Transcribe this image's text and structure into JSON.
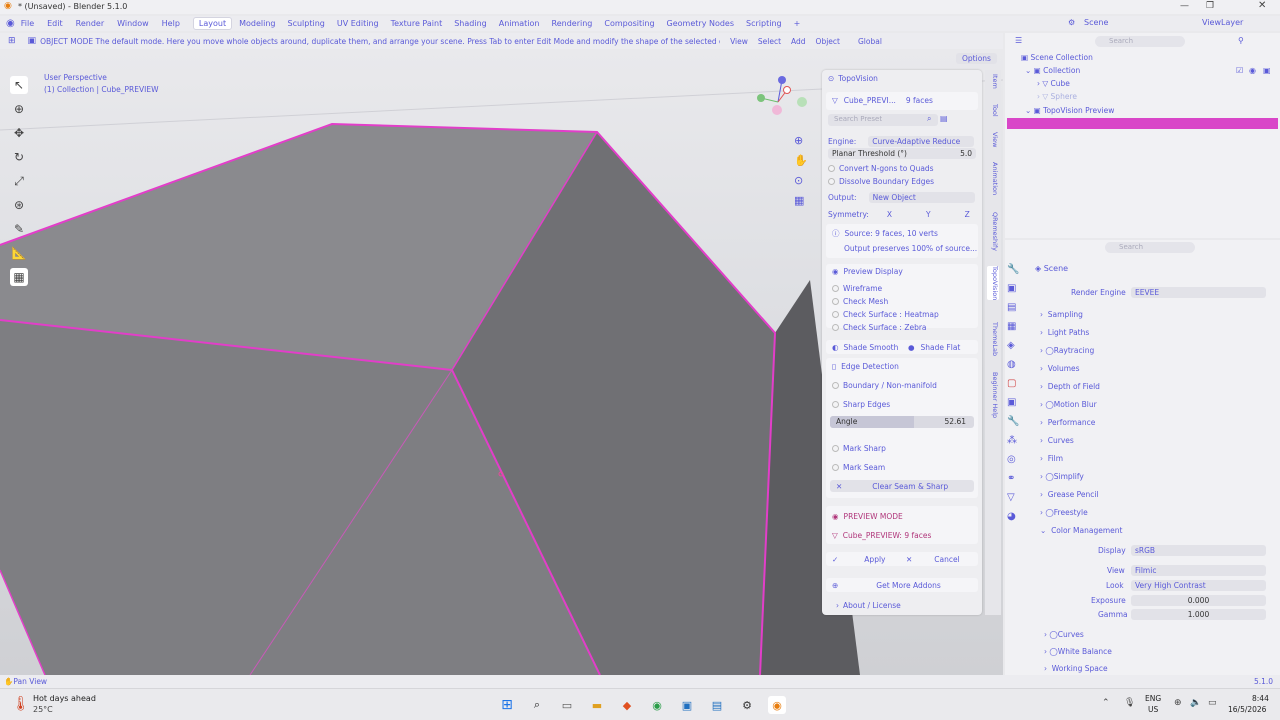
{
  "window": {
    "title": "* (Unsaved) - Blender 5.1.0"
  },
  "menu": {
    "items": [
      "File",
      "Edit",
      "Render",
      "Window",
      "Help"
    ],
    "workspaces": [
      "Layout",
      "Modeling",
      "Sculpting",
      "UV Editing",
      "Texture Paint",
      "Shading",
      "Animation",
      "Rendering",
      "Compositing",
      "Geometry Nodes",
      "Scripting"
    ],
    "active_workspace": "Layout",
    "scene": "Scene",
    "view_layer": "ViewLayer"
  },
  "header": {
    "mode_tooltip": "OBJECT MODE The default mode. Here you move whole objects around, duplicate them, and arrange your scene. Press Tab to enter Edit Mode and modify the shape of the selected object.",
    "view": "View",
    "select": "Select",
    "add": "Add",
    "object": "Object",
    "orientation": "Global",
    "options": "Options"
  },
  "viewport": {
    "perspective": "User Perspective",
    "collection_info": "(1) Collection | Cube_PREVIEW"
  },
  "npanel": {
    "title": "TopoVision",
    "object_name": "Cube_PREVI...",
    "object_faces": "9 faces",
    "search_placeholder": "Search Preset",
    "engine_label": "Engine:",
    "engine_value": "Curve-Adaptive Reduce",
    "threshold_label": "Planar Threshold (°)",
    "threshold_value": "5.0",
    "convert_ngons": "Convert N-gons to Quads",
    "dissolve_boundary": "Dissolve Boundary Edges",
    "output_label": "Output:",
    "output_value": "New Object",
    "symmetry_label": "Symmetry:",
    "sym_x": "X",
    "sym_y": "Y",
    "sym_z": "Z",
    "source_info": "Source: 9 faces, 10 verts",
    "preserve_info": "Output preserves 100% of source...",
    "preview_display": "Preview Display",
    "wireframe": "Wireframe",
    "check_mesh": "Check Mesh",
    "heatmap": "Check Surface : Heatmap",
    "zebra": "Check Surface : Zebra",
    "shade_smooth": "Shade Smooth",
    "shade_flat": "Shade Flat",
    "edge_detection": "Edge Detection",
    "boundary": "Boundary / Non-manifold",
    "sharp_edges": "Sharp Edges",
    "angle_label": "Angle",
    "angle_value": "52.61",
    "angle_fraction": 0.58,
    "mark_sharp": "Mark Sharp",
    "mark_seam": "Mark Seam",
    "clear_seam": "Clear Seam & Sharp",
    "preview_mode": "PREVIEW MODE",
    "preview_obj": "Cube_PREVIEW:  9 faces",
    "apply": "Apply",
    "cancel": "Cancel",
    "get_addons": "Get More Addons",
    "about": "About / License"
  },
  "sidetabs": [
    "Item",
    "Tool",
    "View",
    "Animation",
    "QRemeshify",
    "TopoVision",
    "ThemeLab",
    "Beginner Help"
  ],
  "outliner": {
    "search_placeholder": "Search",
    "scene_collection": "Scene Collection",
    "collection": "Collection",
    "cube": "Cube",
    "sphere": "Sphere",
    "preview": "TopoVision Preview"
  },
  "properties": {
    "search_placeholder": "Search",
    "scene": "Scene",
    "render_engine_label": "Render Engine",
    "render_engine_value": "EEVEE",
    "sections": [
      "Sampling",
      "Light Paths",
      "Raytracing",
      "Volumes",
      "Depth of Field",
      "Motion Blur",
      "Performance",
      "Curves",
      "Film",
      "Simplify",
      "Grease Pencil",
      "Freestyle",
      "Color Management"
    ],
    "display_label": "Display",
    "display_value": "sRGB",
    "view_label": "View",
    "view_value": "Filmic",
    "look_label": "Look",
    "look_value": "Very High Contrast",
    "exposure_label": "Exposure",
    "exposure_value": "0.000",
    "gamma_label": "Gamma",
    "gamma_value": "1.000",
    "sub_curves": "Curves",
    "white_balance": "White Balance",
    "working_space": "Working Space"
  },
  "status": {
    "left": "Pan View",
    "version": "5.1.0"
  },
  "taskbar": {
    "weather_title": "Hot days ahead",
    "weather_temp": "25°C",
    "lang": "ENG",
    "region": "US",
    "time": "8:44",
    "date": "16/5/2026"
  },
  "colors": {
    "accent": "#5a5ad8",
    "selection": "#d946c8"
  }
}
